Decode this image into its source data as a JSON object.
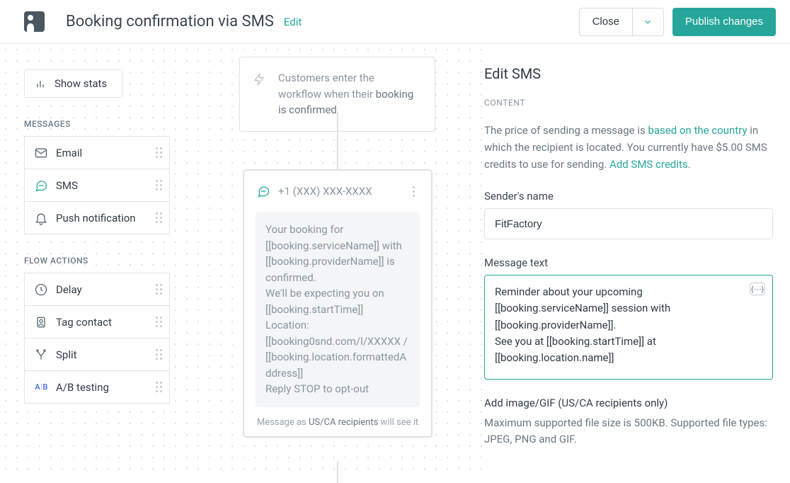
{
  "header": {
    "title": "Booking confirmation via SMS",
    "edit": "Edit",
    "close": "Close",
    "publish": "Publish changes"
  },
  "sidebar": {
    "show_stats": "Show stats",
    "sections": {
      "messages": {
        "label": "MESSAGES",
        "items": [
          {
            "icon": "email-icon",
            "label": "Email"
          },
          {
            "icon": "sms-icon",
            "label": "SMS"
          },
          {
            "icon": "bell-icon",
            "label": "Push notification"
          }
        ]
      },
      "flow": {
        "label": "FLOW ACTIONS",
        "items": [
          {
            "icon": "clock-icon",
            "label": "Delay"
          },
          {
            "icon": "tag-icon",
            "label": "Tag contact"
          },
          {
            "icon": "split-icon",
            "label": "Split"
          },
          {
            "icon": "ab-icon",
            "label": "A/B testing"
          }
        ]
      }
    }
  },
  "canvas": {
    "entry": {
      "prefix": "Customers enter the workflow when their ",
      "emph": "booking is confirmed"
    },
    "sms_node": {
      "number": "+1 (XXX) XXX-XXXX",
      "body": "Your booking for [[booking.serviceName]] with [[booking.providerName]] is confirmed.\nWe'll be expecting you on [[booking.startTime]]\nLocation: [[booking0snd.com/l/XXXXX / [[booking.location.formattedAddress]]\nReply STOP to opt-out",
      "footer_prefix": "Message as ",
      "footer_bold": "US/CA recipients",
      "footer_suffix": " will see it"
    }
  },
  "panel": {
    "title": "Edit SMS",
    "subhead": "CONTENT",
    "desc_prefix": "The price of sending a message is ",
    "desc_link1": "based on the country",
    "desc_mid": " in which the recipient is located. You currently have $5.00 SMS credits to use for sending. ",
    "desc_link2": "Add SMS credits",
    "desc_end": ".",
    "sender_label": "Sender's name",
    "sender_value": "FitFactory",
    "message_label": "Message text",
    "message_value": "Reminder about your upcoming [[booking.serviceName]] session with [[booking.providerName]].\nSee you at [[booking.startTime]] at [[booking.location.name]]",
    "image_head": "Add image/GIF (US/CA recipients only)",
    "image_hint": "Maximum supported file size is 500KB. Supported file types: JPEG, PNG and GIF."
  }
}
